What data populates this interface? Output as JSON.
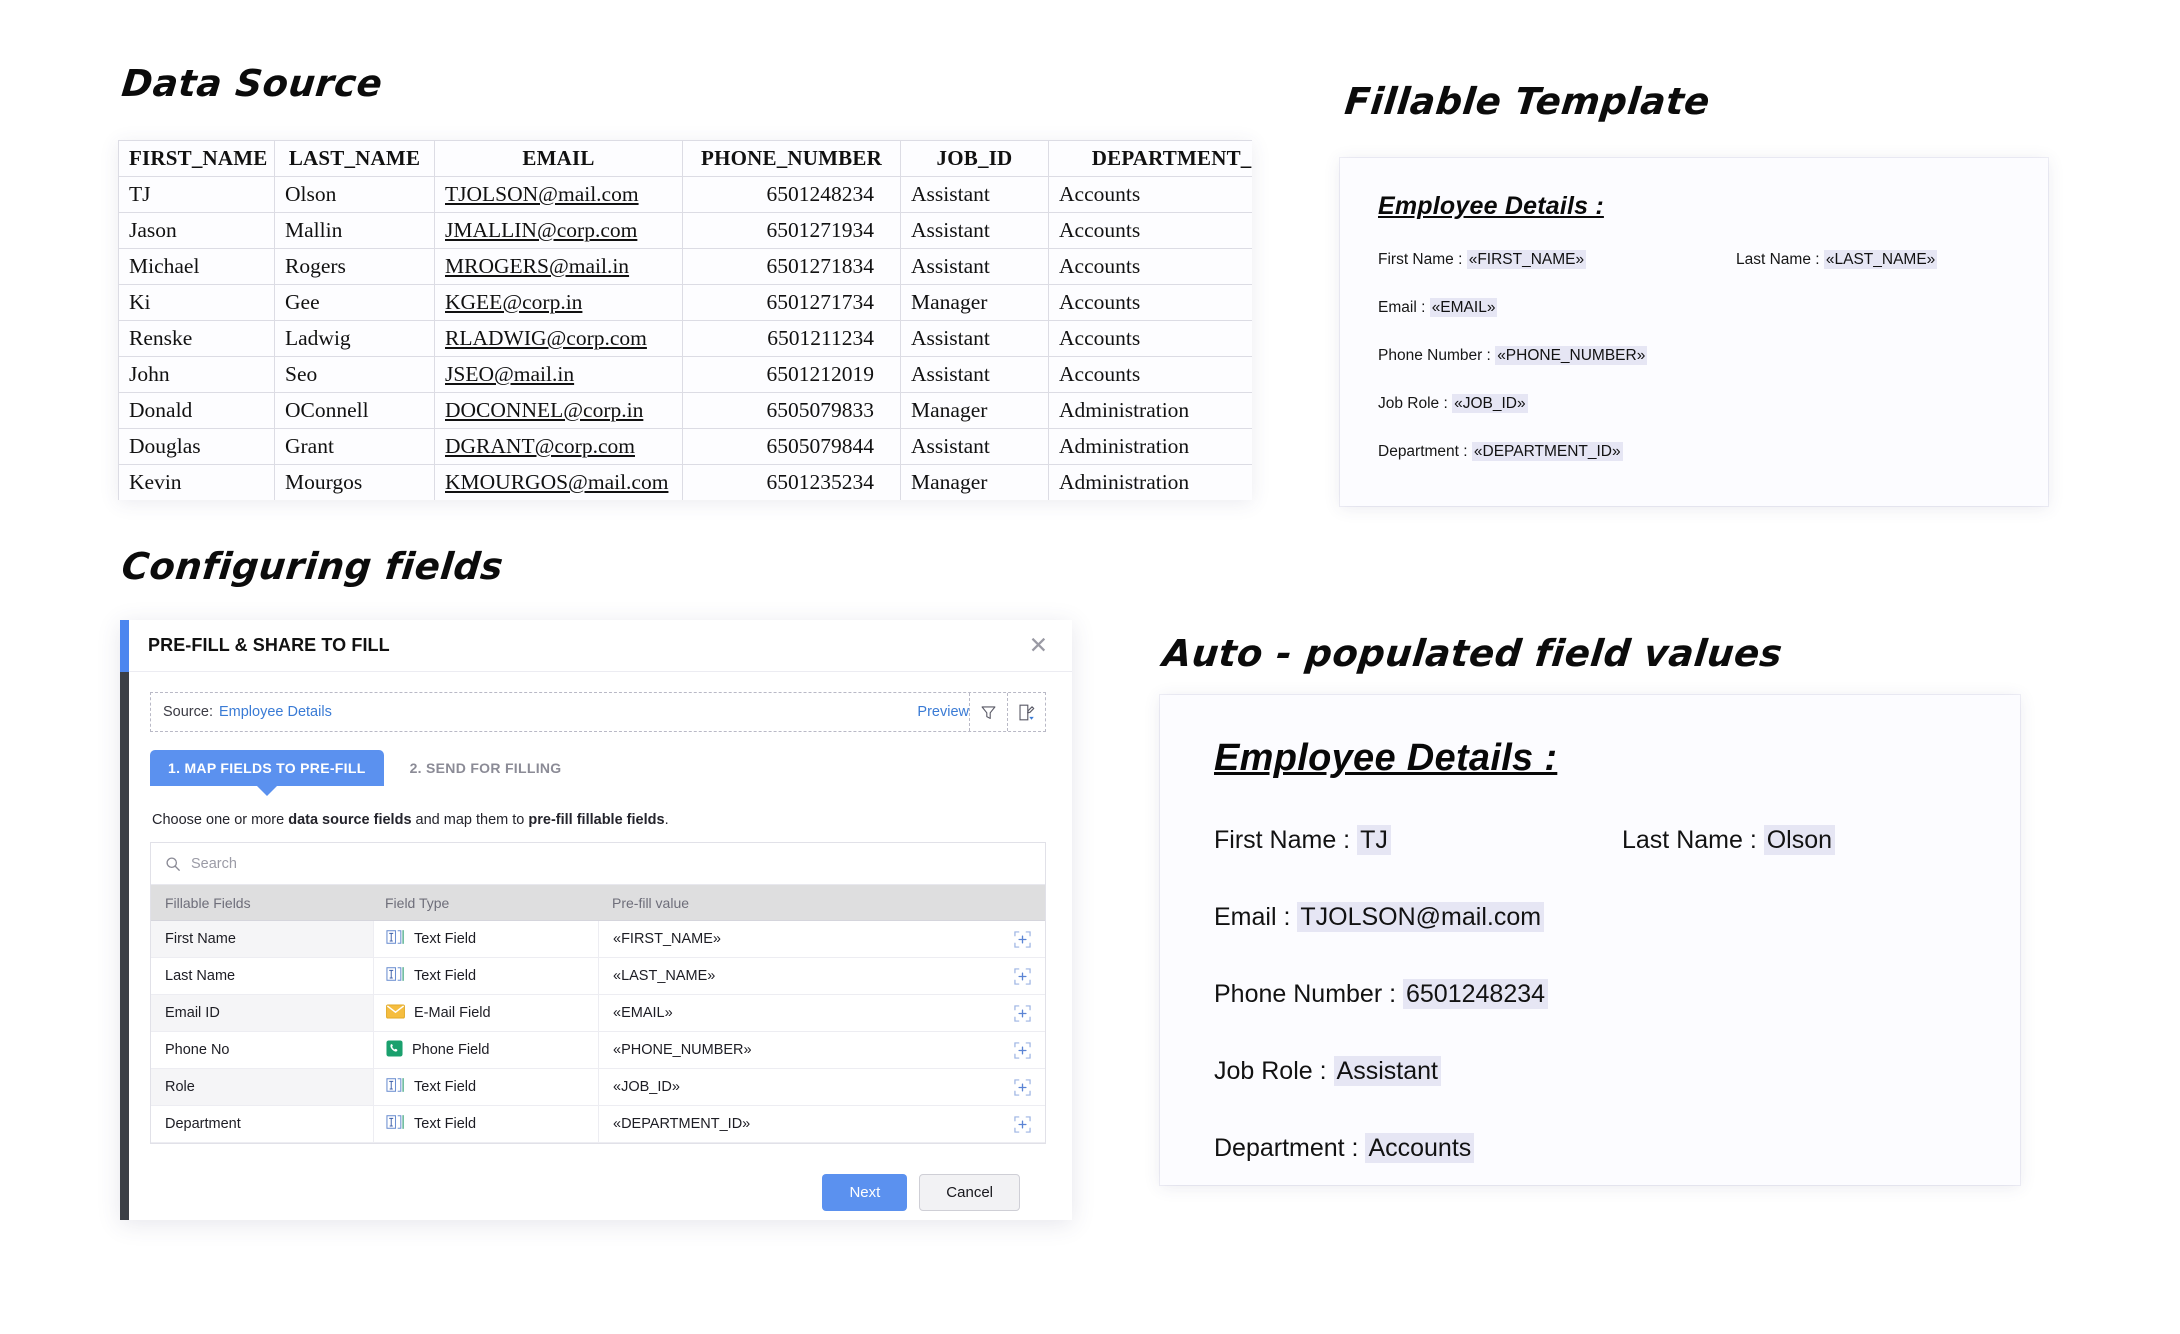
{
  "sections": {
    "data_source_title": "Data Source",
    "fillable_title": "Fillable Template",
    "configuring_title": "Configuring fields",
    "auto_title": "Auto - populated field values"
  },
  "data_source": {
    "columns": [
      "FIRST_NAME",
      "LAST_NAME",
      "EMAIL",
      "PHONE_NUMBER",
      "JOB_ID",
      "DEPARTMENT_ID"
    ],
    "rows": [
      [
        "TJ",
        "Olson",
        "TJOLSON@mail.com",
        "6501248234",
        "Assistant",
        "Accounts"
      ],
      [
        "Jason",
        "Mallin",
        "JMALLIN@corp.com",
        "6501271934",
        "Assistant",
        "Accounts"
      ],
      [
        "Michael",
        "Rogers",
        "MROGERS@mail.in",
        "6501271834",
        "Assistant",
        "Accounts"
      ],
      [
        "Ki",
        "Gee",
        "KGEE@corp.in",
        "6501271734",
        "Manager",
        "Accounts"
      ],
      [
        "Renske",
        "Ladwig",
        "RLADWIG@corp.com",
        "6501211234",
        "Assistant",
        "Accounts"
      ],
      [
        "John",
        "Seo",
        "JSEO@mail.in",
        "6501212019",
        "Assistant",
        "Accounts"
      ],
      [
        "Donald",
        "OConnell",
        "DOCONNEL@corp.in",
        "6505079833",
        "Manager",
        "Administration"
      ],
      [
        "Douglas",
        "Grant",
        "DGRANT@corp.com",
        "6505079844",
        "Assistant",
        "Administration"
      ],
      [
        "Kevin",
        "Mourgos",
        "KMOURGOS@mail.com",
        "6501235234",
        "Manager",
        "Administration"
      ]
    ]
  },
  "fillable_template": {
    "heading": "Employee Details :",
    "rows": [
      {
        "label": "First Name : ",
        "token": "«FIRST_NAME»",
        "label2": "Last Name : ",
        "token2": "«LAST_NAME»"
      },
      {
        "label": "Email : ",
        "token": "«EMAIL»"
      },
      {
        "label": "Phone Number : ",
        "token": "«PHONE_NUMBER»"
      },
      {
        "label": "Job Role : ",
        "token": "«JOB_ID»"
      },
      {
        "label": "Department : ",
        "token": "«DEPARTMENT_ID»"
      }
    ]
  },
  "dialog": {
    "title": "PRE-FILL & SHARE TO FILL",
    "close_label": "✕",
    "source_label": "Source:",
    "source_value": "Employee Details",
    "preview_label": "Preview",
    "filter_icon": "filter-icon",
    "edit_source_icon": "edit-source-icon",
    "tabs": [
      {
        "label": "1. MAP FIELDS TO PRE-FILL",
        "active": true
      },
      {
        "label": "2. SEND FOR FILLING",
        "active": false
      }
    ],
    "hint_a": "Choose one or more ",
    "hint_b": "data source fields",
    "hint_c": " and map them to ",
    "hint_d": "pre-fill fillable fields",
    "hint_e": ".",
    "search_placeholder": "Search",
    "grid_headers": [
      "Fillable Fields",
      "Field Type",
      "Pre-fill value"
    ],
    "grid_rows": [
      {
        "field": "First Name",
        "type": "Text Field",
        "icon": "text-field-icon",
        "value": "«FIRST_NAME»"
      },
      {
        "field": "Last Name",
        "type": "Text Field",
        "icon": "text-field-icon",
        "value": "«LAST_NAME»"
      },
      {
        "field": "Email ID",
        "type": "E-Mail Field",
        "icon": "email-field-icon",
        "value": "«EMAIL»"
      },
      {
        "field": "Phone No",
        "type": "Phone Field",
        "icon": "phone-field-icon",
        "value": "«PHONE_NUMBER»"
      },
      {
        "field": "Role",
        "type": "Text Field",
        "icon": "text-field-icon",
        "value": "«JOB_ID»"
      },
      {
        "field": "Department",
        "type": "Text Field",
        "icon": "text-field-icon",
        "value": "«DEPARTMENT_ID»"
      }
    ],
    "next_label": "Next",
    "cancel_label": "Cancel"
  },
  "auto_populated": {
    "heading": "Employee Details :",
    "rows": [
      {
        "label": "First Name : ",
        "value": "TJ",
        "label2": "Last Name : ",
        "value2": "Olson"
      },
      {
        "label": "Email : ",
        "value": "TJOLSON@mail.com"
      },
      {
        "label": "Phone Number : ",
        "value": "6501248234"
      },
      {
        "label": "Job Role : ",
        "value": "Assistant"
      },
      {
        "label": "Department : ",
        "value": "Accounts"
      }
    ]
  },
  "colors": {
    "accent_blue": "#5b91ef",
    "edge_blue": "#4c86ef",
    "edge_dark": "#3b3f46",
    "link_blue": "#3a7bd5",
    "token_highlight": "#e6e6f4",
    "grid_header_bg": "#dededf",
    "email_icon": "#f0b429",
    "phone_icon": "#1aa06d"
  }
}
